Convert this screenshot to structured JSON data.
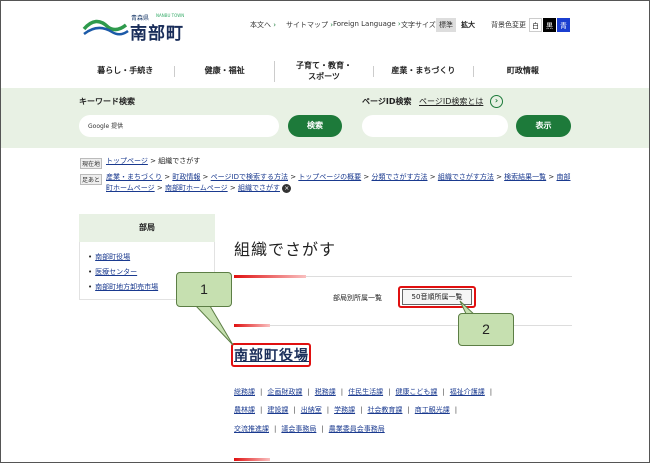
{
  "header": {
    "logo_small": "青森県",
    "logo_small_en": "NANBU TOWN",
    "logo_main": "南部町",
    "util_links": [
      "本文へ",
      "サイトマップ",
      "Foreign Language"
    ],
    "font_size_label": "文字サイズ",
    "font_size_options": [
      "標準",
      "拡大"
    ],
    "bg_label": "背景色変更",
    "bg_options": [
      "白",
      "黒",
      "青"
    ]
  },
  "nav": {
    "items": [
      "暮らし・手続き",
      "健康・福祉",
      "子育て・教育・\nスポーツ",
      "産業・まちづくり",
      "町政情報"
    ]
  },
  "search": {
    "keyword_label": "キーワード検索",
    "keyword_placeholder": "Google 提供",
    "keyword_button": "検索",
    "pageid_label": "ページID検索",
    "pageid_link": "ページID検索とは",
    "pageid_button": "表示"
  },
  "breadcrumb": {
    "current_tag": "現在地",
    "current": [
      "トップページ",
      "組織でさがす"
    ],
    "footprint_tag": "足あと",
    "footprint": [
      "産業・まちづくり",
      "町政情報",
      "ページIDで検索する方法",
      "トップページの概要",
      "分類でさがす方法",
      "組織でさがす方法",
      "検索結果一覧",
      "南部町ホームページ",
      "南部町ホームページ",
      "組織でさがす"
    ]
  },
  "sidebar": {
    "heading": "部局",
    "items": [
      "南部町役場",
      "医療センター",
      "南部町地方卸売市場"
    ]
  },
  "main": {
    "title": "組織でさがす",
    "list_label": "部局別所属一覧",
    "gojuon_button": "50音順所属一覧",
    "dept_title": "南部町役場",
    "dept_rows": [
      [
        "総務課",
        "企画財政課",
        "税務課",
        "住民生活課",
        "健康こども課",
        "福祉介護課"
      ],
      [
        "農林課",
        "建設課",
        "出納室",
        "学務課",
        "社会教育課",
        "商工観光課"
      ],
      [
        "交流推進課",
        "議会事務局",
        "農業委員会事務局"
      ]
    ]
  },
  "annotations": {
    "callout_1": "1",
    "callout_2": "2"
  },
  "colors": {
    "brand_green": "#1d7a3a",
    "band_bg": "#e8f1e4",
    "callout_fill": "#c6e0b0",
    "highlight_red": "#e01010"
  }
}
